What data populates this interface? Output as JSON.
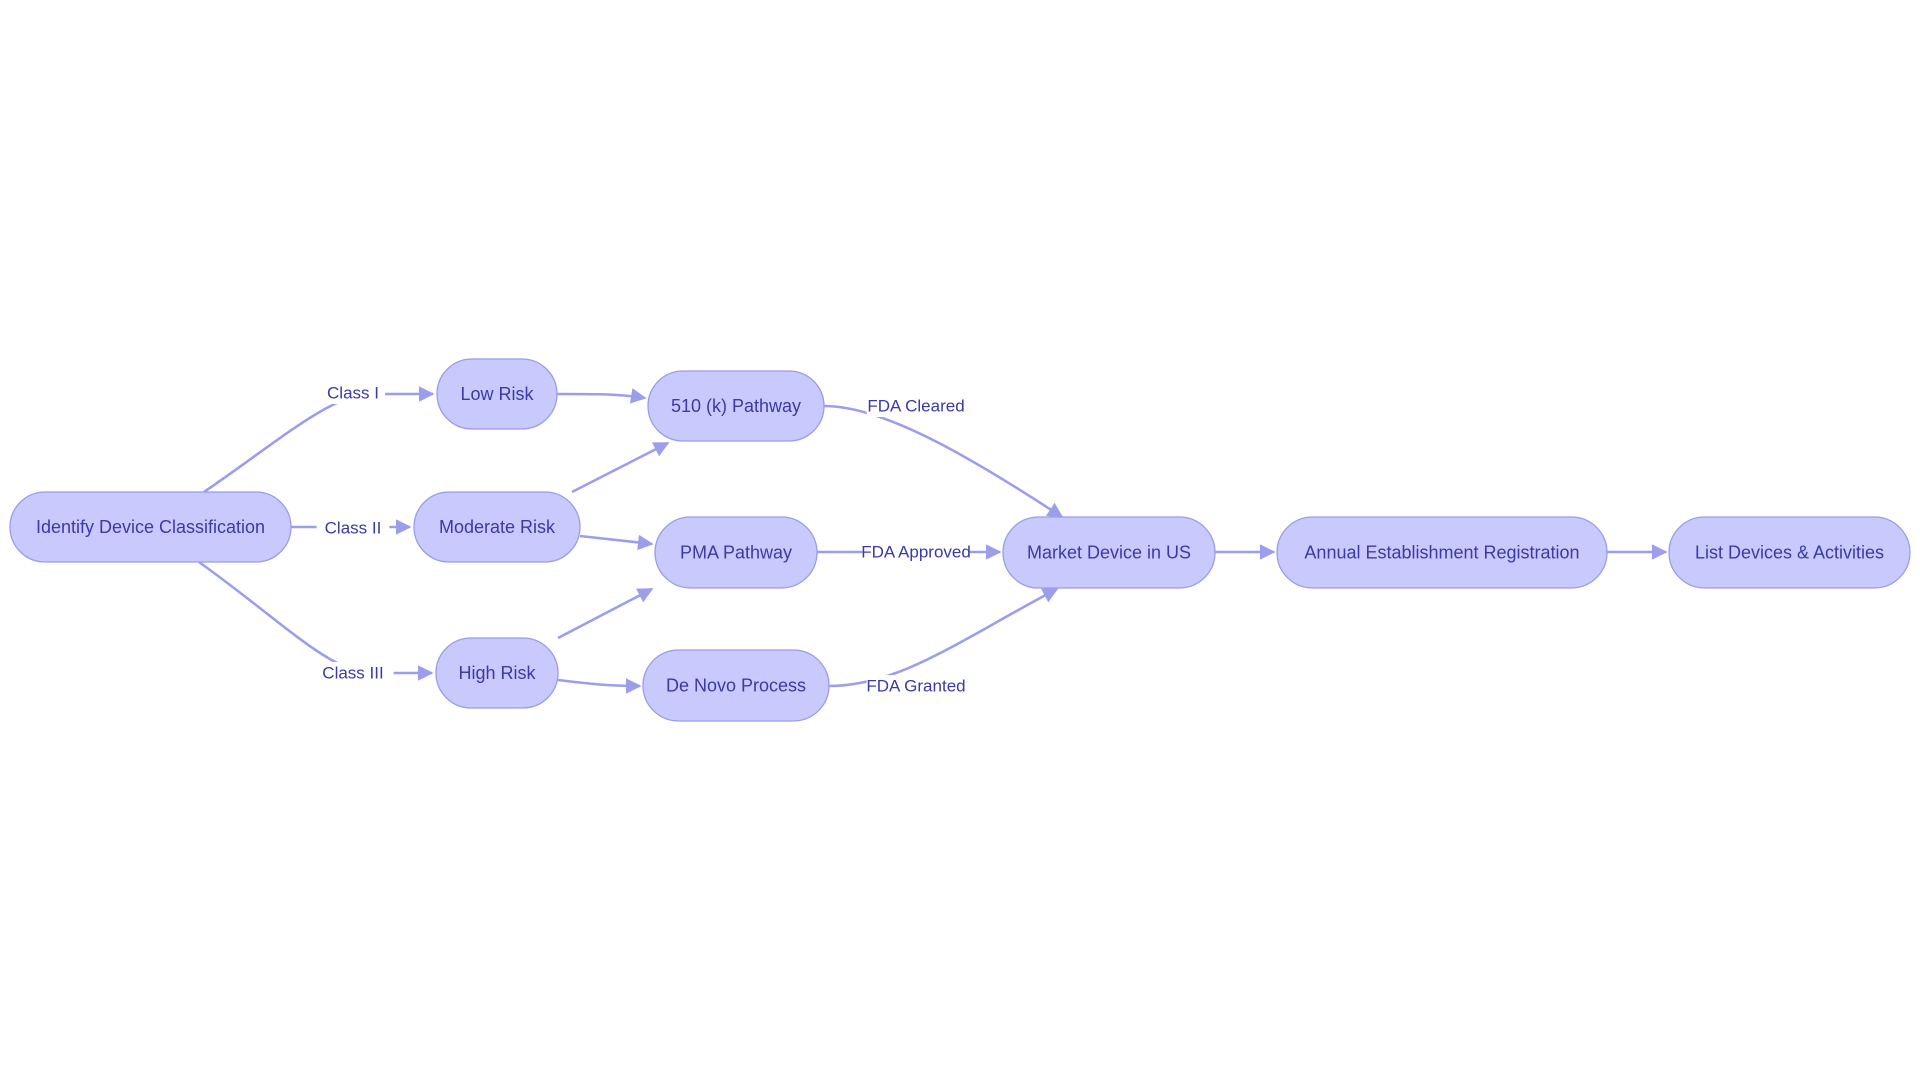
{
  "colors": {
    "node_fill": "#c8c9fc",
    "node_stroke": "#9a9cec",
    "edge": "#9c9eec",
    "text": "#3a3aa8",
    "background": "#ffffff"
  },
  "nodes": {
    "identify": "Identify Device Classification",
    "low": "Low Risk",
    "moderate": "Moderate Risk",
    "high": "High Risk",
    "k510": "510 (k) Pathway",
    "pma": "PMA Pathway",
    "denovo": "De Novo Process",
    "market": "Market Device in US",
    "annual": "Annual Establishment Registration",
    "list": "List Devices & Activities"
  },
  "edges": [
    {
      "from": "identify",
      "to": "low",
      "label": "Class I"
    },
    {
      "from": "identify",
      "to": "moderate",
      "label": "Class II"
    },
    {
      "from": "identify",
      "to": "high",
      "label": "Class III"
    },
    {
      "from": "low",
      "to": "k510",
      "label": ""
    },
    {
      "from": "moderate",
      "to": "k510",
      "label": ""
    },
    {
      "from": "moderate",
      "to": "pma",
      "label": ""
    },
    {
      "from": "high",
      "to": "pma",
      "label": ""
    },
    {
      "from": "high",
      "to": "denovo",
      "label": ""
    },
    {
      "from": "k510",
      "to": "market",
      "label": "FDA Cleared"
    },
    {
      "from": "pma",
      "to": "market",
      "label": "FDA Approved"
    },
    {
      "from": "denovo",
      "to": "market",
      "label": "FDA Granted"
    },
    {
      "from": "market",
      "to": "annual",
      "label": ""
    },
    {
      "from": "annual",
      "to": "list",
      "label": ""
    }
  ]
}
